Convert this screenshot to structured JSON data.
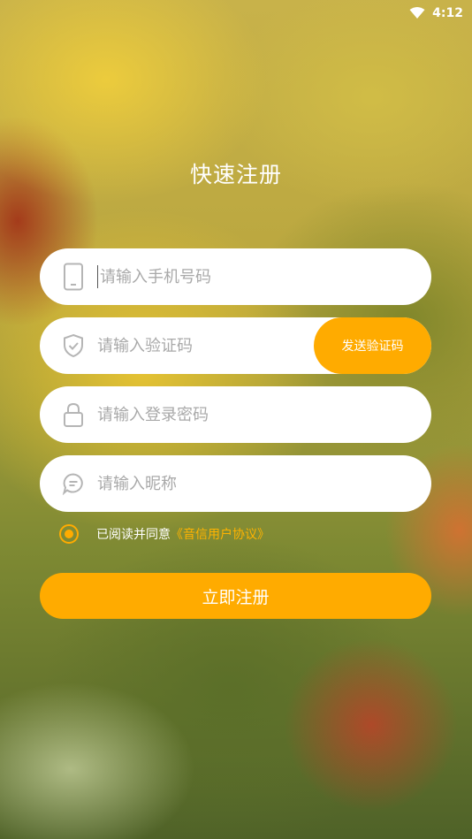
{
  "status_bar": {
    "time": "4:12",
    "wifi_icon": "wifi-icon"
  },
  "page_title": "快速注册",
  "form": {
    "phone": {
      "placeholder": "请输入手机号码",
      "icon": "phone-icon"
    },
    "code": {
      "placeholder": "请输入验证码",
      "icon": "shield-check-icon",
      "send_label": "发送验证码"
    },
    "password": {
      "placeholder": "请输入登录密码",
      "icon": "lock-icon"
    },
    "nickname": {
      "placeholder": "请输入昵称",
      "icon": "chat-bubble-icon"
    }
  },
  "agreement": {
    "checked": true,
    "text": "已阅读并同意",
    "link": "《音信用户协议》"
  },
  "submit_label": "立即注册",
  "colors": {
    "accent": "#ffab00",
    "field_bg": "#ffffff",
    "placeholder": "#a9a9a9"
  }
}
